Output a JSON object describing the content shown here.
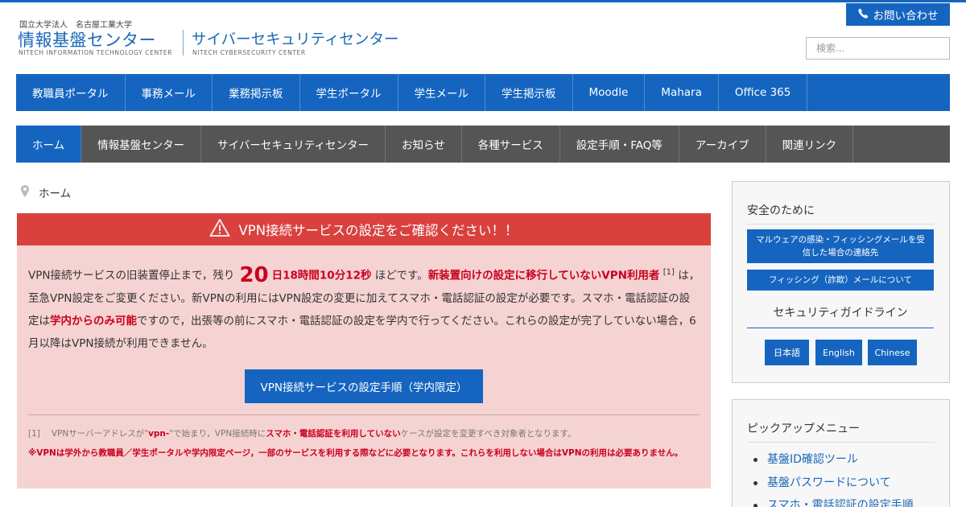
{
  "header": {
    "university": "国立大学法人　名古屋工業大学",
    "site_title": "情報基盤センター",
    "site_subtitle": "NITECH INFORMATION TECHNOLOGY CENTER",
    "site2_title": "サイバーセキュリティセンター",
    "site2_subtitle": "NITECH CYBERSECURITY CENTER",
    "contact_label": "お問い合わせ",
    "search_placeholder": "検索..."
  },
  "portal_nav": {
    "items": [
      "教職員ポータル",
      "事務メール",
      "業務掲示板",
      "学生ポータル",
      "学生メール",
      "学生掲示板",
      "Moodle",
      "Mahara",
      "Office 365"
    ]
  },
  "main_nav": {
    "items": [
      "ホーム",
      "情報基盤センター",
      "サイバーセキュリティセンター",
      "お知らせ",
      "各種サービス",
      "設定手順・FAQ等",
      "アーカイブ",
      "関連リンク"
    ],
    "active_index": 0
  },
  "breadcrumb": {
    "current": "ホーム"
  },
  "alert": {
    "title": "VPN接続サービスの設定をご確認ください！！",
    "p1_a": "VPN接続サービスの旧装置停止まで，残り",
    "days": "20",
    "countdown_rest": "日18時間10分12秒",
    "p1_b": "ほどです。",
    "highlight1": "新装置向けの設定に移行していないVPN利用者",
    "ref": "[1]",
    "p1_c": "は，至急VPN設定をご変更ください。新VPNの利用にはVPN設定の変更に加えてスマホ・電話認証の設定が必要です。スマホ・電話認証の設定は",
    "highlight2": "学内からのみ可能",
    "p1_d": "ですので，出張等の前にスマホ・電話認証の設定を学内で行ってください。これらの設定が完了していない場合，6月以降はVPN接続が利用できません。",
    "button": "VPN接続サービスの設定手順（学内限定）",
    "fn_tag": "[1]",
    "fn_a": "VPNサーバーアドレスが\"",
    "fn_b": "vpn-",
    "fn_c": "\"で始まり，VPN接続時に",
    "fn_d": "スマホ・電話認証を利用していない",
    "fn_e": "ケースが設定を変更すべき対象者となります。",
    "fn2": "※VPNは学外から教職員／学生ポータルや学内限定ページ，一部のサービスを利用する際などに必要となります。これらを利用しない場合はVPNの利用は必要ありません。"
  },
  "sidebar_safety": {
    "heading": "安全のために",
    "btn1": "マルウェアの感染・フィッシングメールを受信した場合の連絡先",
    "btn2": "フィッシング（詐欺）メールについて",
    "guideline": "セキュリティガイドライン",
    "langs": [
      "日本語",
      "English",
      "Chinese"
    ]
  },
  "sidebar_pickup": {
    "heading": "ピックアップメニュー",
    "items": [
      "基盤ID確認ツール",
      "基盤パスワードについて",
      "スマホ・電話認証の設定手順"
    ]
  },
  "colors": {
    "brand_blue": "#1565c0",
    "alert_red": "#d9413f",
    "alert_bg": "#f6d3d3",
    "nav_gray": "#555555"
  }
}
